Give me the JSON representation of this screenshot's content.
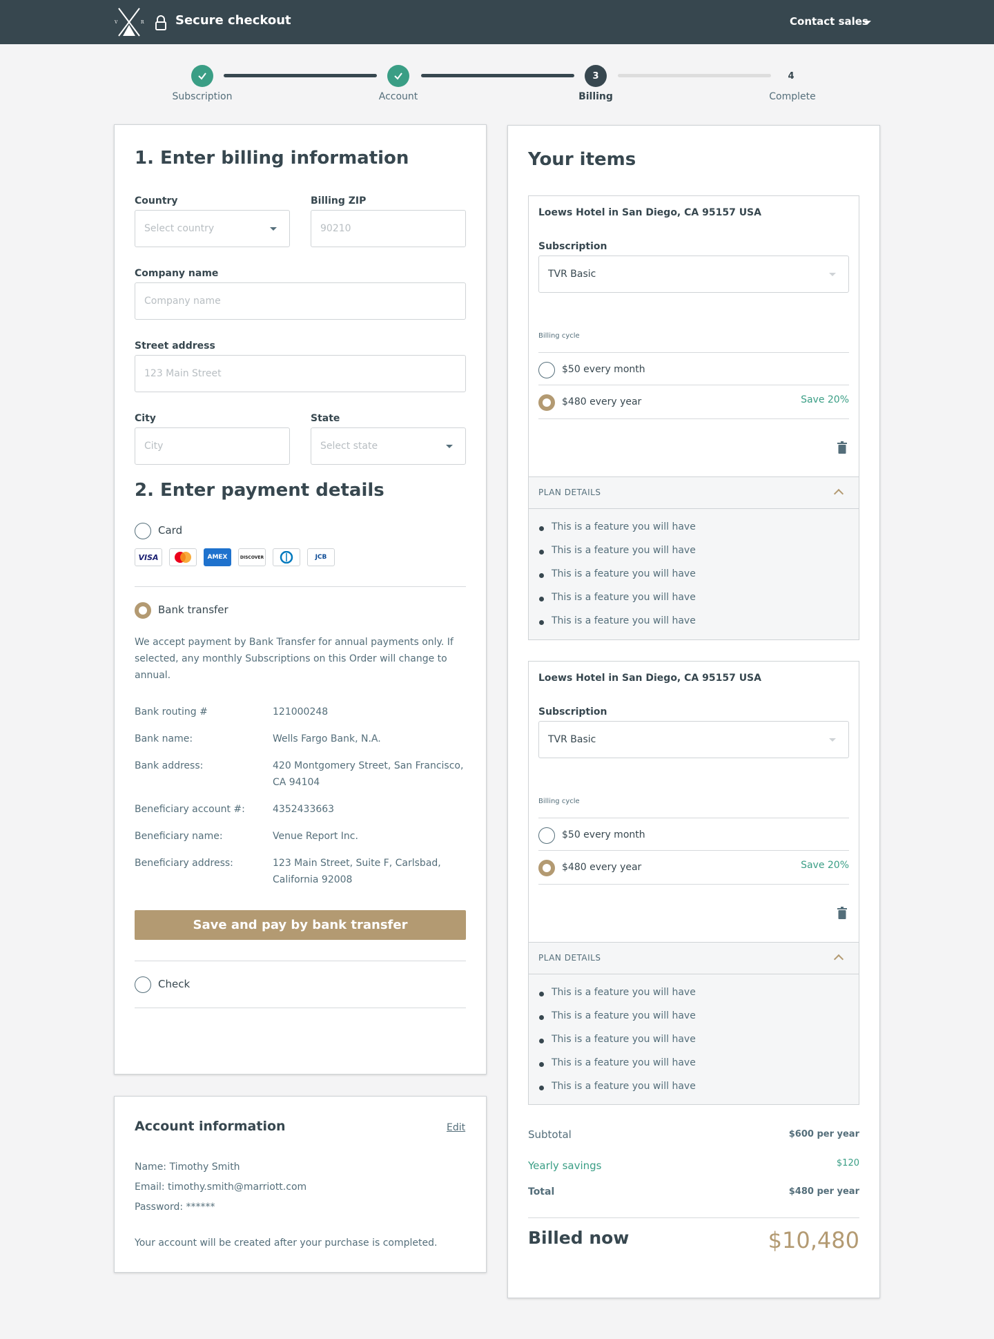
{
  "header": {
    "logo": "VR",
    "title": "Secure checkout",
    "contact": "Contact sales"
  },
  "steps": [
    {
      "label": "Subscription",
      "state": "done",
      "number": ""
    },
    {
      "label": "Account",
      "state": "done",
      "number": ""
    },
    {
      "label": "Billing",
      "state": "current",
      "number": "3"
    },
    {
      "label": "Complete",
      "state": "todo",
      "number": "4"
    }
  ],
  "billing": {
    "heading": "1. Enter billing information",
    "country_label": "Country",
    "country_placeholder": "Select country",
    "zip_label": "Billing ZIP",
    "zip_placeholder": "90210",
    "company_label": "Company name",
    "company_placeholder": "Company name",
    "street_label": "Street address",
    "street_placeholder": "123 Main Street",
    "city_label": "City",
    "city_placeholder": "City",
    "state_label": "State",
    "state_placeholder": "Select state"
  },
  "payment": {
    "heading": "2. Enter payment details",
    "card_label": "Card",
    "card_logos": [
      "VISA",
      "",
      "AMEX",
      "DISCOVER",
      "",
      "JCB"
    ],
    "bank_label": "Bank transfer",
    "bank_note": "We accept payment by Bank Transfer for annual payments only. If selected, any monthly Subscriptions on this Order will change to annual.",
    "bank_details": [
      {
        "key": "Bank routing #",
        "value": "121000248"
      },
      {
        "key": "Bank name:",
        "value": "Wells Fargo Bank, N.A."
      },
      {
        "key": "Bank address:",
        "value": "420 Montgomery Street, San Francisco, CA 94104"
      },
      {
        "key": "Beneficiary account #:",
        "value": "4352433663"
      },
      {
        "key": "Beneficiary name:",
        "value": "Venue Report Inc."
      },
      {
        "key": "Beneficiary address:",
        "value": "123 Main Street, Suite F, Carlsbad, California 92008"
      }
    ],
    "pay_button": "Save and pay by bank transfer",
    "check_label": "Check"
  },
  "account": {
    "heading": "Account information",
    "edit": "Edit",
    "name": "Name: Timothy Smith",
    "email": "Email: timothy.smith@marriott.com",
    "password": "Password: ******",
    "note": "Your account will be created after your purchase is completed."
  },
  "items": {
    "heading": "Your items",
    "list": [
      {
        "venue": "Loews Hotel in San Diego, CA 95157 USA",
        "subscription_label": "Subscription",
        "subscription_value": "TVR Basic",
        "billing_cycle_label": "Billing cycle",
        "monthly": "$50 every month",
        "yearly": "$480 every year",
        "save": "Save 20%",
        "plan_details": "PLAN DETAILS",
        "features": [
          "This is a feature you will have",
          "This is a feature you will have",
          "This is a feature you will have",
          "This is a feature you will have",
          "This is a feature you will have"
        ]
      },
      {
        "venue": "Loews Hotel in San Diego, CA 95157 USA",
        "subscription_label": "Subscription",
        "subscription_value": "TVR Basic",
        "billing_cycle_label": "Billing cycle",
        "monthly": "$50 every month",
        "yearly": "$480 every year",
        "save": "Save 20%",
        "plan_details": "PLAN DETAILS",
        "features": [
          "This is a feature you will have",
          "This is a feature you will have",
          "This is a feature you will have",
          "This is a feature you will have",
          "This is a feature you will have"
        ]
      }
    ]
  },
  "summary": {
    "subtotal_label": "Subtotal",
    "subtotal_value": "$600 per year",
    "savings_label": "Yearly savings",
    "savings_value": "$120",
    "total_label": "Total",
    "total_value": "$480 per year",
    "billed_label": "Billed now",
    "billed_value": "$10,480"
  },
  "colors": {
    "header": "#37474f",
    "accent": "#b39a72",
    "success": "#3a9e85"
  }
}
